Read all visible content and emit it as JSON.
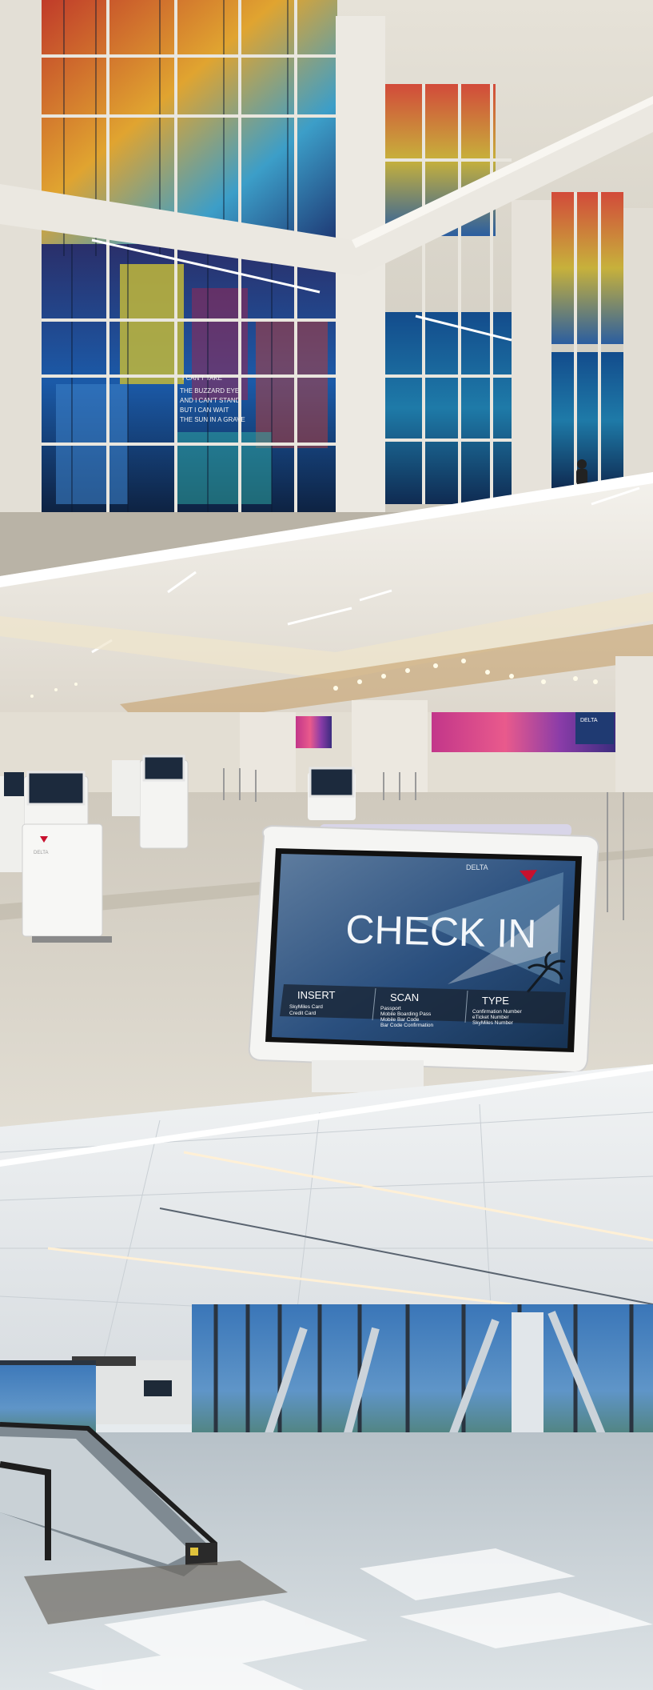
{
  "panel_top": {
    "mural_lines": [
      "I CAN'T TAKE",
      "THE BUZZARD EYE",
      "AND I CAN'T STAND",
      "BUT I CAN WAIT",
      "THE SUN IN A GRAVE"
    ]
  },
  "panel_middle": {
    "kiosk": {
      "brand": "DELTA",
      "title": "CHECK IN",
      "options": [
        {
          "label": "INSERT",
          "lines": [
            "SkyMiles Card",
            "Credit Card"
          ]
        },
        {
          "label": "SCAN",
          "lines": [
            "Passport",
            "Mobile Boarding Pass",
            "Mobile Bar Code",
            "Bar Code Confirmation"
          ]
        },
        {
          "label": "TYPE",
          "lines": [
            "Confirmation Number",
            "eTicket Number",
            "SkyMiles Number"
          ]
        }
      ],
      "front_kiosk_logo": "DELTA"
    },
    "sign_delta": "DELTA"
  },
  "colors": {
    "ceiling": "#f2f0ea",
    "floor": "#d6d1c5",
    "delta_red": "#c8102e",
    "screen_blue": "#1e3e6e"
  }
}
